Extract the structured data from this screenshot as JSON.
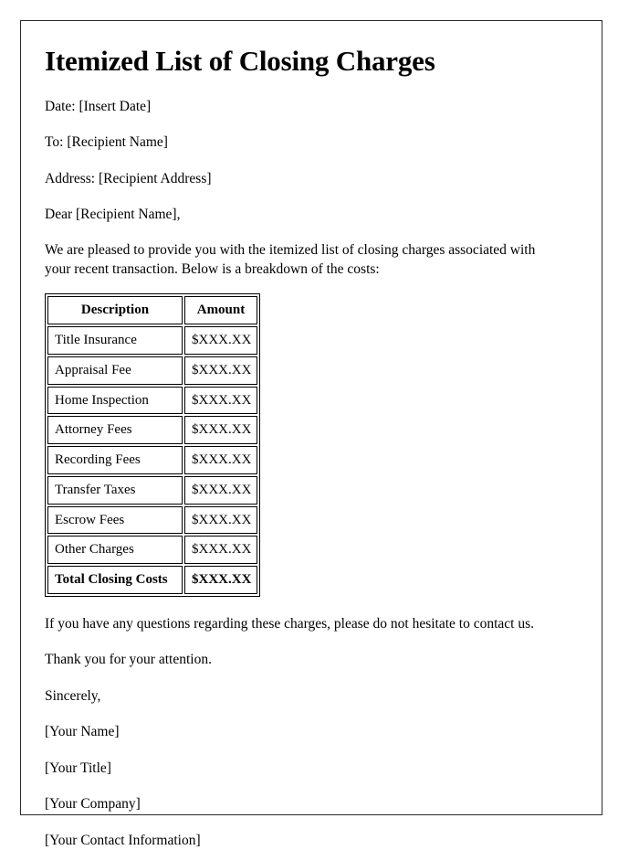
{
  "document": {
    "title": "Itemized List of Closing Charges",
    "header_lines": [
      "Date: [Insert Date]",
      "To: [Recipient Name]",
      "Address: [Recipient Address]",
      "Dear [Recipient Name],"
    ],
    "intro_paragraph": "We are pleased to provide you with the itemized list of closing charges associated with your recent transaction. Below is a breakdown of the costs:",
    "table": {
      "columns": [
        "Description",
        "Amount"
      ],
      "rows": [
        {
          "description": "Title Insurance",
          "amount": "$XXX.XX",
          "emphasis": false
        },
        {
          "description": "Appraisal Fee",
          "amount": "$XXX.XX",
          "emphasis": false
        },
        {
          "description": "Home Inspection",
          "amount": "$XXX.XX",
          "emphasis": false
        },
        {
          "description": "Attorney Fees",
          "amount": "$XXX.XX",
          "emphasis": false
        },
        {
          "description": "Recording Fees",
          "amount": "$XXX.XX",
          "emphasis": false
        },
        {
          "description": "Transfer Taxes",
          "amount": "$XXX.XX",
          "emphasis": false
        },
        {
          "description": "Escrow Fees",
          "amount": "$XXX.XX",
          "emphasis": false
        },
        {
          "description": "Other Charges",
          "amount": "$XXX.XX",
          "emphasis": false
        },
        {
          "description": "Total Closing Costs",
          "amount": "$XXX.XX",
          "emphasis": true
        }
      ]
    },
    "closing_paragraphs": [
      "If you have any questions regarding these charges, please do not hesitate to contact us.",
      "Thank you for your attention.",
      "Sincerely,"
    ],
    "signature_lines": [
      "[Your Name]",
      "[Your Title]",
      "[Your Company]",
      "[Your Contact Information]"
    ]
  },
  "colors": {
    "page_background": "#ffffff",
    "text": "#000000",
    "page_border": "#2b2b2b",
    "table_border": "#000000"
  }
}
